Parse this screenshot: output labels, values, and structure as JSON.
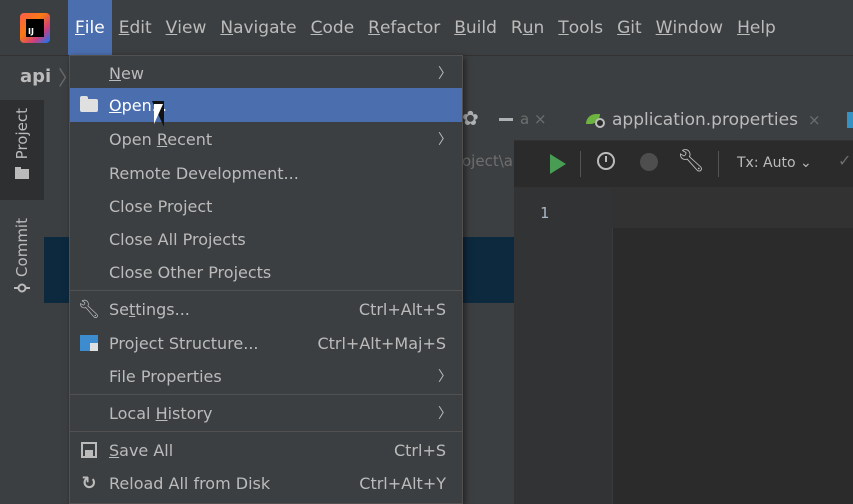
{
  "menubar": {
    "logo_text": "IJ",
    "items": [
      {
        "pre": "",
        "mn": "F",
        "post": "ile"
      },
      {
        "pre": "",
        "mn": "E",
        "post": "dit"
      },
      {
        "pre": "",
        "mn": "V",
        "post": "iew"
      },
      {
        "pre": "",
        "mn": "N",
        "post": "avigate"
      },
      {
        "pre": "",
        "mn": "C",
        "post": "ode"
      },
      {
        "pre": "",
        "mn": "R",
        "post": "efactor"
      },
      {
        "pre": "",
        "mn": "B",
        "post": "uild"
      },
      {
        "pre": "R",
        "mn": "u",
        "post": "n"
      },
      {
        "pre": "",
        "mn": "T",
        "post": "ools"
      },
      {
        "pre": "",
        "mn": "G",
        "post": "it"
      },
      {
        "pre": "",
        "mn": "W",
        "post": "indow"
      },
      {
        "pre": "",
        "mn": "H",
        "post": "elp"
      }
    ]
  },
  "navbar": {
    "project": "api",
    "separator": "〉"
  },
  "sidebar": {
    "tabs": [
      "Project",
      "Commit"
    ]
  },
  "project_panel": {
    "path_fragment": "oject\\api"
  },
  "editor": {
    "prev_tab": "a ×",
    "active_tab": "application.properties",
    "tab_close": "×",
    "tx_label": "Tx: Auto ⌄",
    "line_number": "1"
  },
  "file_menu": {
    "items": [
      {
        "pre": "",
        "mn": "N",
        "post": "ew",
        "shortcut": "",
        "arrow": "〉"
      },
      {
        "pre": "",
        "mn": "O",
        "post": "pen...",
        "shortcut": "",
        "arrow": ""
      },
      {
        "pre": "Open ",
        "mn": "R",
        "post": "ecent",
        "shortcut": "",
        "arrow": "〉"
      },
      {
        "pre": "Remote Development...",
        "mn": "",
        "post": "",
        "shortcut": "",
        "arrow": ""
      },
      {
        "pre": "Close Pro",
        "mn": "j",
        "post": "ect",
        "shortcut": "",
        "arrow": ""
      },
      {
        "pre": "Close All Projects",
        "mn": "",
        "post": "",
        "shortcut": "",
        "arrow": ""
      },
      {
        "pre": "Close Other Projects",
        "mn": "",
        "post": "",
        "shortcut": "",
        "arrow": ""
      },
      {
        "pre": "Se",
        "mn": "t",
        "post": "tings...",
        "shortcut": "Ctrl+Alt+S",
        "arrow": ""
      },
      {
        "pre": "Project Structure...",
        "mn": "",
        "post": "",
        "shortcut": "Ctrl+Alt+Maj+S",
        "arrow": ""
      },
      {
        "pre": "File Properties",
        "mn": "",
        "post": "",
        "shortcut": "",
        "arrow": "〉"
      },
      {
        "pre": "Local ",
        "mn": "H",
        "post": "istory",
        "shortcut": "",
        "arrow": "〉"
      },
      {
        "pre": "",
        "mn": "S",
        "post": "ave All",
        "shortcut": "Ctrl+S",
        "arrow": ""
      },
      {
        "pre": "Reload All from Disk",
        "mn": "",
        "post": "",
        "shortcut": "Ctrl+Alt+Y",
        "arrow": ""
      }
    ]
  },
  "colors": {
    "highlight": "#4b6eaf",
    "menubar": "#3c3f41",
    "editor": "#2b2b2b"
  }
}
